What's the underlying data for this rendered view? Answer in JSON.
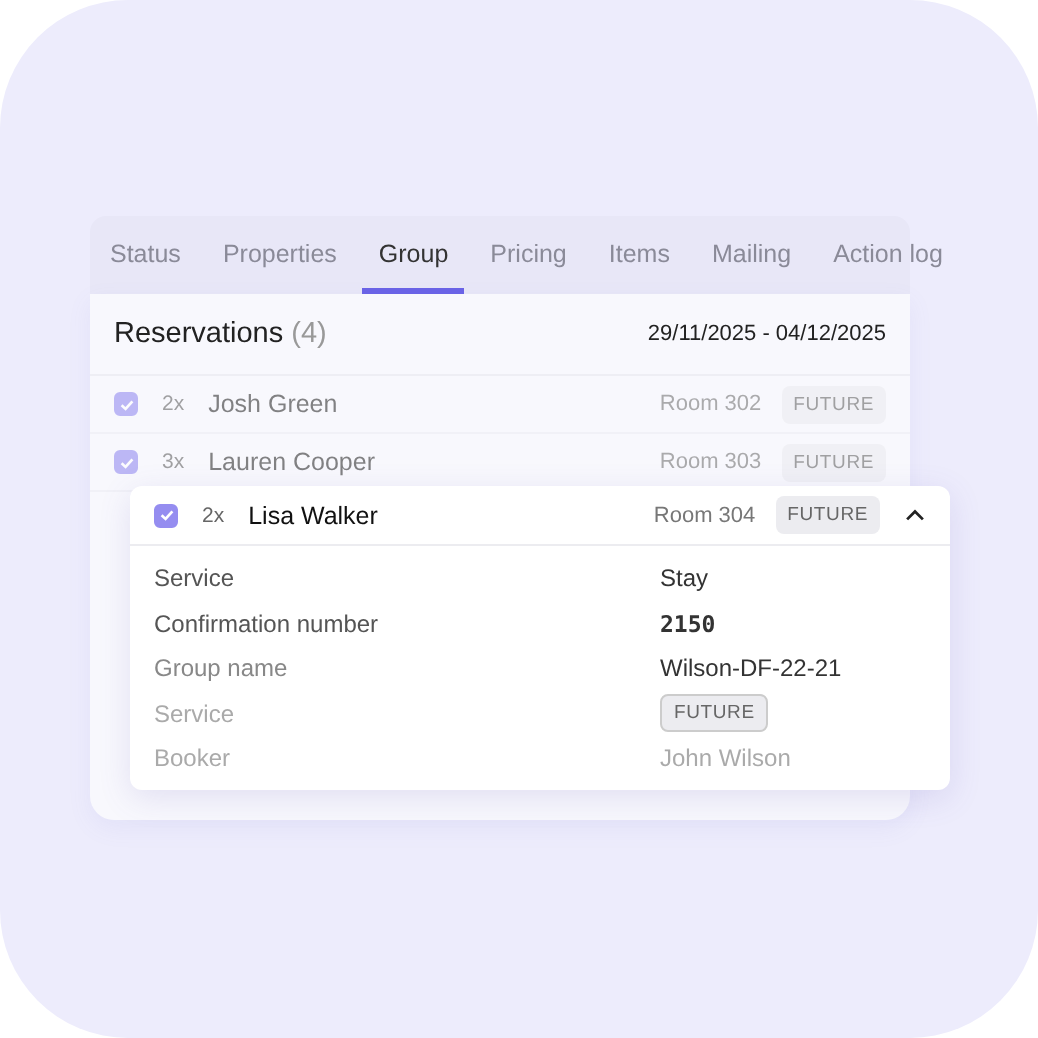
{
  "tabs": [
    {
      "label": "Status",
      "selected": false
    },
    {
      "label": "Properties",
      "selected": false
    },
    {
      "label": "Group",
      "selected": true
    },
    {
      "label": "Pricing",
      "selected": false
    },
    {
      "label": "Items",
      "selected": false
    },
    {
      "label": "Mailing",
      "selected": false
    },
    {
      "label": "Action log",
      "selected": false
    }
  ],
  "reservations": {
    "title": "Reservations",
    "count": "(4)",
    "dates": "29/11/2025 - 04/12/2025",
    "rows": [
      {
        "checked": true,
        "multiplier": "2x",
        "name": "Josh Green",
        "room": "Room 302",
        "status": "FUTURE"
      },
      {
        "checked": true,
        "multiplier": "3x",
        "name": "Lauren Cooper",
        "room": "Room 303",
        "status": "FUTURE"
      }
    ]
  },
  "detail": {
    "checked": true,
    "multiplier": "2x",
    "name": "Lisa Walker",
    "room": "Room 304",
    "status": "FUTURE",
    "expanded": true,
    "fields": [
      {
        "label": "Service",
        "kind": "text",
        "value": "Stay"
      },
      {
        "label": "Confirmation number",
        "kind": "code",
        "value": "2150"
      },
      {
        "label": "Group name",
        "kind": "text",
        "value": "Wilson-DF-22-21"
      },
      {
        "label": "Service",
        "kind": "badge",
        "value": "FUTURE"
      },
      {
        "label": "Booker",
        "kind": "text",
        "value": "John Wilson"
      }
    ]
  }
}
